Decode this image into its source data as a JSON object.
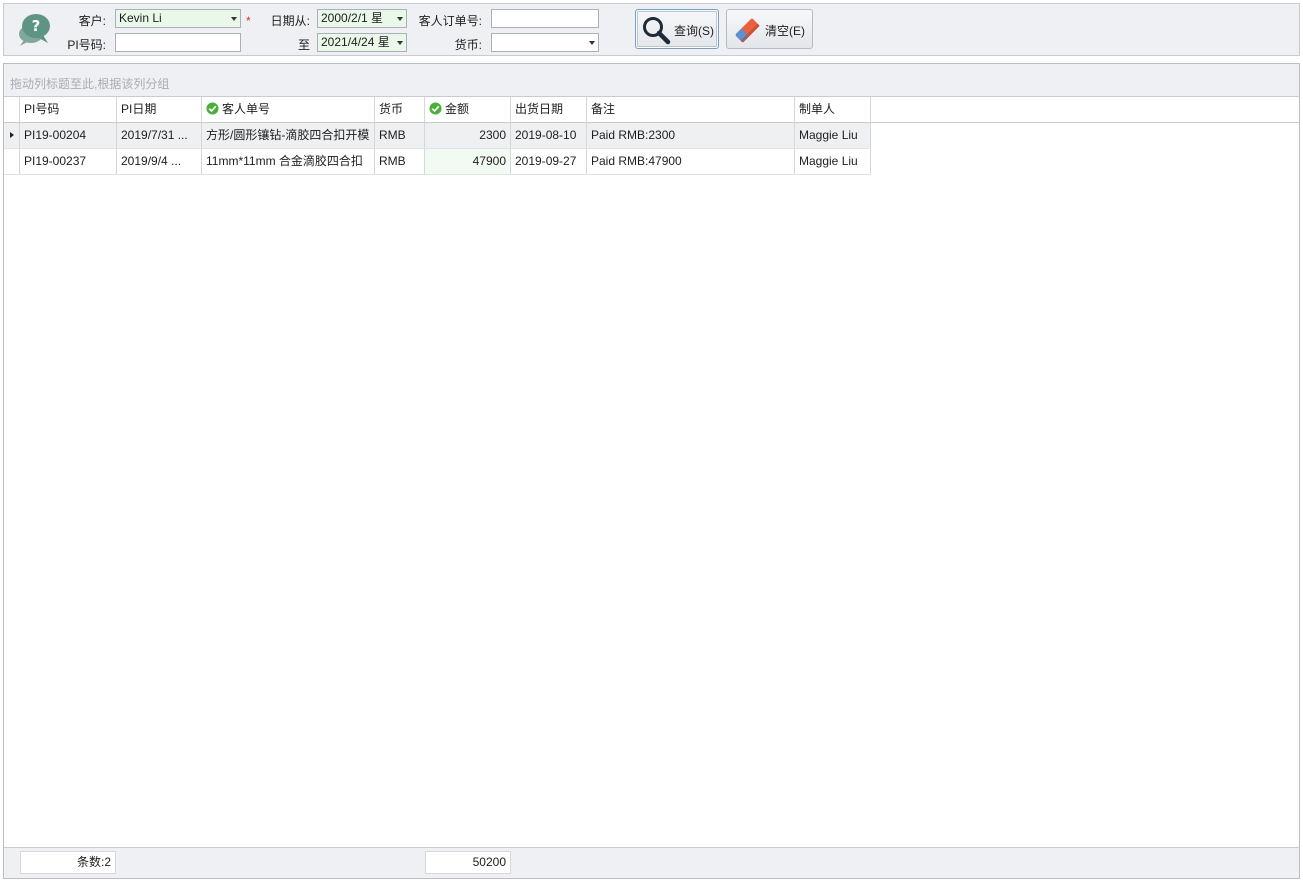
{
  "filters": {
    "customer_label": "客户:",
    "customer_value": "Kevin Li",
    "required_mark": "*",
    "date_from_label": "日期从:",
    "date_from_value": "2000/2/1 星",
    "date_to_label": "至",
    "date_to_value": "2021/4/24 星",
    "cust_order_label": "客人订单号:",
    "cust_order_value": "",
    "pi_label": "PI号码:",
    "pi_value": "",
    "currency_label": "货币:",
    "currency_value": ""
  },
  "buttons": {
    "query_label": "查询(S)",
    "clear_label": "清空(E)"
  },
  "grid": {
    "group_hint": "拖动列标题至此,根据该列分组",
    "columns": [
      "PI号码",
      "PI日期",
      "客人单号",
      "货币",
      "金额",
      "出货日期",
      "备注",
      "制单人"
    ],
    "rows": [
      {
        "pi_no": "PI19-00204",
        "pi_date": "2019/7/31 ...",
        "cust_no": "方形/圆形镶钻-滴胶四合扣开模",
        "currency": "RMB",
        "amount": "2300",
        "ship_date": "2019-08-10",
        "remark": "Paid RMB:2300",
        "maker": "Maggie Liu"
      },
      {
        "pi_no": "PI19-00237",
        "pi_date": "2019/9/4 ...",
        "cust_no": "11mm*11mm 合金滴胶四合扣",
        "currency": "RMB",
        "amount": "47900",
        "ship_date": "2019-09-27",
        "remark": "Paid RMB:47900",
        "maker": "Maggie Liu"
      }
    ]
  },
  "footer": {
    "count_text": "条数:2",
    "amount_total": "50200"
  },
  "colors": {
    "accent_green": "#4caf3c",
    "required_red": "#e0312d"
  },
  "icons": {
    "help": "question-bubble-icon",
    "search": "magnifier-icon",
    "clear": "eraser-icon",
    "filter": "check-circle-icon"
  }
}
